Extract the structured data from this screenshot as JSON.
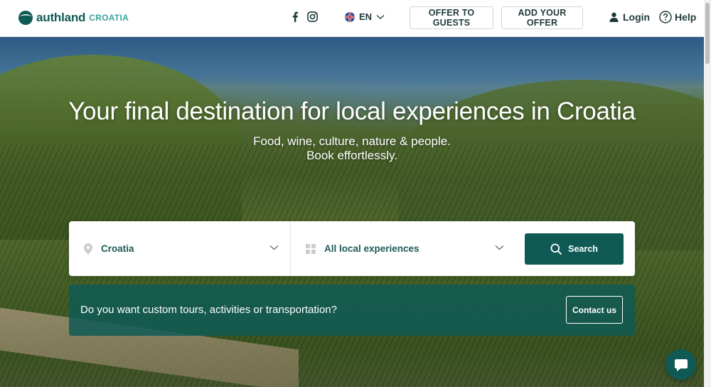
{
  "header": {
    "logo": {
      "name": "authland",
      "suffix": "CROATIA"
    },
    "social": {
      "facebook_icon": "facebook-icon",
      "instagram_icon": "instagram-icon"
    },
    "language": {
      "code": "EN",
      "flag_icon": "uk-flag-icon"
    },
    "buttons": {
      "offer_to_guests": "OFFER TO GUESTS",
      "add_your_offer": "ADD YOUR OFFER"
    },
    "login_label": "Login",
    "help_label": "Help"
  },
  "hero": {
    "title": "Your final destination for local experiences in Croatia",
    "subtitle_line1": "Food, wine, culture, nature & people.",
    "subtitle_line2": "Book effortlessly."
  },
  "search": {
    "location_value": "Croatia",
    "category_value": "All local experiences",
    "button_label": "Search"
  },
  "banner": {
    "text": "Do you want custom tours, activities or transportation?",
    "button_label": "Contact us"
  },
  "colors": {
    "brand": "#0f5a55",
    "brand_light": "#3aa39b"
  }
}
